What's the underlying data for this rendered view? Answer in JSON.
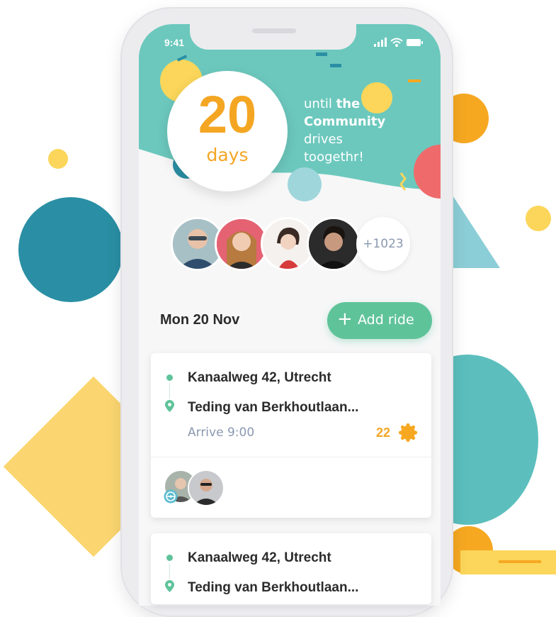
{
  "status_bar": {
    "time": "9:41"
  },
  "countdown": {
    "number": "20",
    "unit": "days",
    "caption_line1_prefix": "until ",
    "caption_line1_bold": "the",
    "caption_line2": "Community",
    "caption_line3": "drives",
    "caption_line4": "toogethr!"
  },
  "participants": {
    "extra_count": "+1023"
  },
  "rides_header": {
    "date": "Mon 20 Nov",
    "add_button_label": "Add ride"
  },
  "rides": [
    {
      "from": "Kanaalweg 42, Utrecht",
      "to": "Teding van Berkhoutlaan...",
      "arrive": "Arrive 9:00",
      "points": "22"
    },
    {
      "from": "Kanaalweg 42, Utrecht",
      "to": "Teding van Berkhoutlaan..."
    }
  ],
  "colors": {
    "teal": "#5bc4b8",
    "accent_orange": "#f4a623",
    "button_green": "#5fc39a"
  }
}
